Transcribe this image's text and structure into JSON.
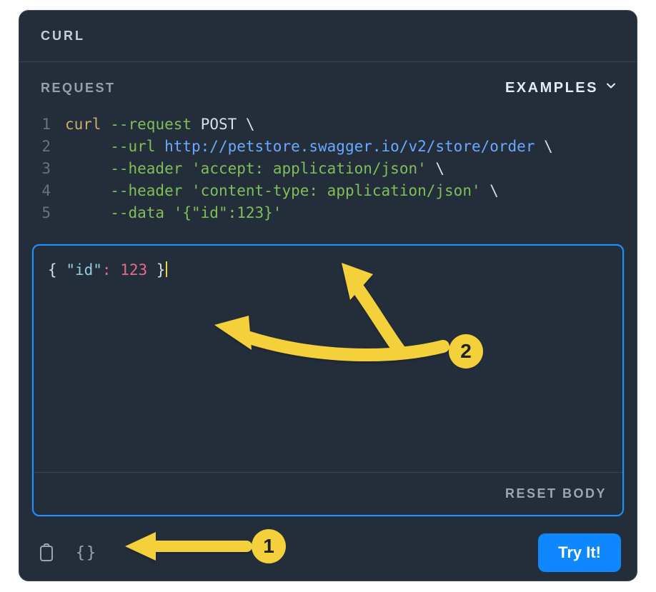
{
  "header": {
    "title": "CURL"
  },
  "subheader": {
    "request_label": "REQUEST",
    "examples_label": "EXAMPLES"
  },
  "code": {
    "lines": [
      {
        "n": "1",
        "cmd": "curl",
        "flag": "--request",
        "method": "POST",
        "cont": " \\"
      },
      {
        "n": "2",
        "indent": "     ",
        "flag": "--url",
        "url": "http://petstore.swagger.io/v2/store/order",
        "cont": " \\"
      },
      {
        "n": "3",
        "indent": "     ",
        "flag": "--header",
        "str": "'accept: application/json'",
        "cont": " \\"
      },
      {
        "n": "4",
        "indent": "     ",
        "flag": "--header",
        "str": "'content-type: application/json'",
        "cont": " \\"
      },
      {
        "n": "5",
        "indent": "     ",
        "flag": "--data",
        "str": "'{\"id\":123}'",
        "cont": ""
      }
    ]
  },
  "body_editor": {
    "open": "{",
    "key_quoted": "\"id\"",
    "colon": ":",
    "value": "123",
    "close": "}"
  },
  "body_footer": {
    "reset_label": "RESET BODY"
  },
  "bottom": {
    "braces_label": "{}",
    "try_it_label": "Try It!"
  },
  "annotations": {
    "badge1": "1",
    "badge2": "2"
  },
  "colors": {
    "panel_bg": "#242e3a",
    "accent_blue": "#1f90ff",
    "annotation_yellow": "#f4d13a",
    "primary_button": "#0f87ff"
  }
}
